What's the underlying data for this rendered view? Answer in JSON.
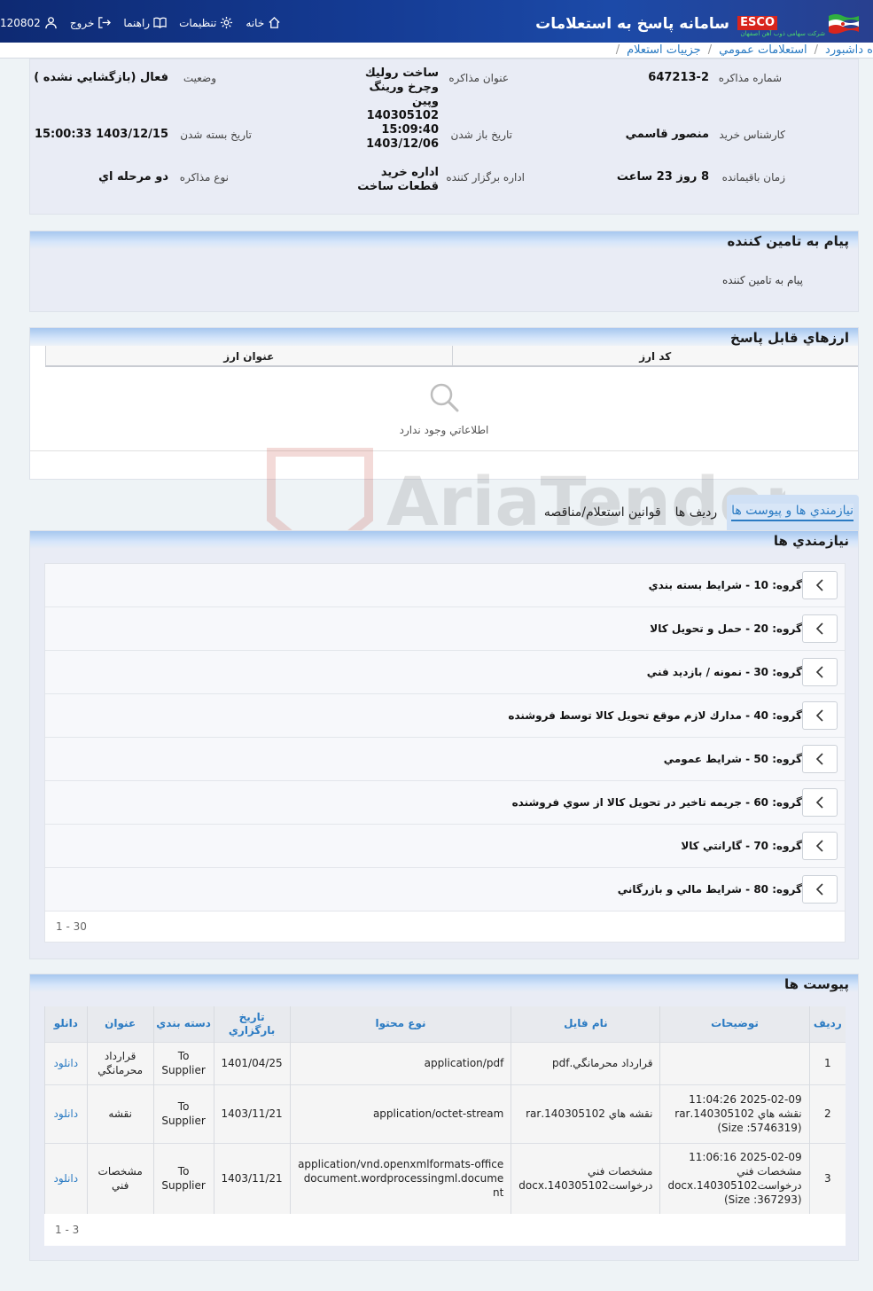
{
  "header": {
    "title": "سامانه پاسخ به استعلامات",
    "brand": "ESCO",
    "brand_sub": "شرکت سهامی ذوب آهن اصفهان",
    "nav": {
      "home": "خانه",
      "settings": "تنظيمات",
      "help": "راهنما",
      "logout": "خروج",
      "user": "120802"
    }
  },
  "breadcrumb": [
    "ه داشبورد",
    "استعلامات عمومي",
    "جزييات استعلام"
  ],
  "info": {
    "number_label": "شماره مذاکره",
    "number": "647213-2",
    "subject_label": "عنوان مذاکره",
    "subject": "ساخت روليك وچرخ ورينگ وپين 140305102",
    "status_label": "وضعيت",
    "status": "فعال (بازگشايي نشده )",
    "expert_label": "کارشناس خريد",
    "expert": "منصور قاسمي",
    "open_label": "تاريخ باز شدن",
    "open_time": "15:09:40",
    "open_date": "1403/12/06",
    "close_label": "تاريخ بسته شدن",
    "close": "1403/12/15 15:00:33",
    "remaining_label": "زمان باقيمانده",
    "remaining": "8 روز 23 ساعت",
    "dept_label": "اداره برگزار کننده",
    "dept": "اداره خريد قطعات ساخت",
    "type_label": "نوع مذاکره",
    "type": "دو مرحله اي"
  },
  "message": {
    "title": "پيام به تامين کننده",
    "body": "پيام به تامين کننده"
  },
  "currencies": {
    "title": "ارزهاي قابل پاسخ",
    "col_code": "کد ارز",
    "col_title": "عنوان ارز",
    "empty": "اطلاعاتي وجود ندارد"
  },
  "watermark": "AriaTender.neT",
  "tabs": [
    "نيازمندي ها و پيوست ها",
    "رديف ها",
    "قوانين استعلام/مناقصه"
  ],
  "requirements": {
    "title": "نيازمندي ها",
    "items": [
      "گروه: 10 - شرايط بسته بندي",
      "گروه: 20 - حمل و تحويل کالا",
      "گروه: 30 - نمونه / بازديد فني",
      "گروه: 40 - مدارك لازم موقع تحويل كالا توسط فروشنده",
      "گروه: 50 - شرايط عمومي",
      "گروه: 60 - جريمه تاخير در تحويل کالا از سوي فروشنده",
      "گروه: 70 - گارانتي کالا",
      "گروه: 80 - شرايط مالي و بازرگاني"
    ],
    "pager": "1 - 30"
  },
  "attachments": {
    "title": "پيوست ها",
    "columns": [
      "رديف",
      "توضيحات",
      "نام فايل",
      "نوع محتوا",
      "تاريخ بارگزاري",
      "دسته بندي",
      "عنوان",
      "دانلو"
    ],
    "rows": [
      {
        "idx": "1",
        "desc": "",
        "file": "قرارداد محرمانگي.pdf",
        "type": "application/pdf",
        "date": "1401/04/25",
        "cat": "To Supplier",
        "title": "قرارداد محرمانگي",
        "dl": "دانلود"
      },
      {
        "idx": "2",
        "desc": "2025-02-09 11:04:26 نقشه هاي 140305102.rar (Size :5746319)",
        "file": "نقشه هاي 140305102.rar",
        "type": "application/octet-stream",
        "date": "1403/11/21",
        "cat": "To Supplier",
        "title": "نقشه",
        "dl": "دانلود"
      },
      {
        "idx": "3",
        "desc": "2025-02-09 11:06:16 مشخصات فني درخواست140305102.docx (Size :367293)",
        "file": "مشخصات فني درخواست140305102.docx",
        "type": "application/vnd.openxmlformats-officedocument.wordprocessingml.document",
        "date": "1403/11/21",
        "cat": "To Supplier",
        "title": "مشخصات فني",
        "dl": "دانلود"
      }
    ],
    "pager": "1 - 3"
  }
}
